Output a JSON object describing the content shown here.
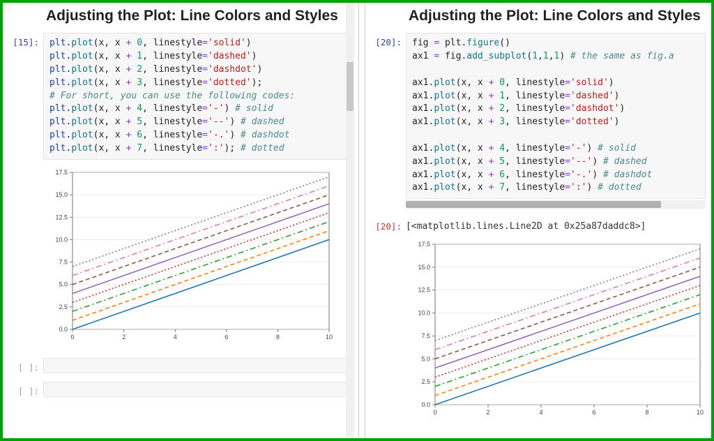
{
  "left": {
    "heading": "Adjusting the Plot: Line Colors and Styles",
    "prompt_in": "[15]:",
    "code_lines": [
      [
        [
          "plt",
          "k-blue"
        ],
        [
          ".",
          ""
        ],
        [
          "plot",
          "k-teal"
        ],
        [
          "(x, x ",
          ""
        ],
        [
          "+",
          "k-op"
        ],
        [
          " ",
          ""
        ],
        [
          "0",
          "k-green"
        ],
        [
          ", linestyle",
          ""
        ],
        [
          "=",
          "k-op"
        ],
        [
          "'solid'",
          "k-red"
        ],
        [
          ")",
          ""
        ]
      ],
      [
        [
          "plt",
          "k-blue"
        ],
        [
          ".",
          ""
        ],
        [
          "plot",
          "k-teal"
        ],
        [
          "(x, x ",
          ""
        ],
        [
          "+",
          "k-op"
        ],
        [
          " ",
          ""
        ],
        [
          "1",
          "k-green"
        ],
        [
          ", linestyle",
          ""
        ],
        [
          "=",
          "k-op"
        ],
        [
          "'dashed'",
          "k-red"
        ],
        [
          ")",
          ""
        ]
      ],
      [
        [
          "plt",
          "k-blue"
        ],
        [
          ".",
          ""
        ],
        [
          "plot",
          "k-teal"
        ],
        [
          "(x, x ",
          ""
        ],
        [
          "+",
          "k-op"
        ],
        [
          " ",
          ""
        ],
        [
          "2",
          "k-green"
        ],
        [
          ", linestyle",
          ""
        ],
        [
          "=",
          "k-op"
        ],
        [
          "'dashdot'",
          "k-red"
        ],
        [
          ")",
          ""
        ]
      ],
      [
        [
          "plt",
          "k-blue"
        ],
        [
          ".",
          ""
        ],
        [
          "plot",
          "k-teal"
        ],
        [
          "(x, x ",
          ""
        ],
        [
          "+",
          "k-op"
        ],
        [
          " ",
          ""
        ],
        [
          "3",
          "k-green"
        ],
        [
          ", linestyle",
          ""
        ],
        [
          "=",
          "k-op"
        ],
        [
          "'dotted'",
          "k-red"
        ],
        [
          ");",
          ""
        ]
      ],
      [
        [
          "# For short, you can use the following codes:",
          "k-cmt"
        ]
      ],
      [
        [
          "plt",
          "k-blue"
        ],
        [
          ".",
          ""
        ],
        [
          "plot",
          "k-teal"
        ],
        [
          "(x, x ",
          ""
        ],
        [
          "+",
          "k-op"
        ],
        [
          " ",
          ""
        ],
        [
          "4",
          "k-green"
        ],
        [
          ", linestyle",
          ""
        ],
        [
          "=",
          "k-op"
        ],
        [
          "'-'",
          "k-red"
        ],
        [
          ") ",
          ""
        ],
        [
          "# solid",
          "k-cmt"
        ]
      ],
      [
        [
          "plt",
          "k-blue"
        ],
        [
          ".",
          ""
        ],
        [
          "plot",
          "k-teal"
        ],
        [
          "(x, x ",
          ""
        ],
        [
          "+",
          "k-op"
        ],
        [
          " ",
          ""
        ],
        [
          "5",
          "k-green"
        ],
        [
          ", linestyle",
          ""
        ],
        [
          "=",
          "k-op"
        ],
        [
          "'--'",
          "k-red"
        ],
        [
          ") ",
          ""
        ],
        [
          "# dashed",
          "k-cmt"
        ]
      ],
      [
        [
          "plt",
          "k-blue"
        ],
        [
          ".",
          ""
        ],
        [
          "plot",
          "k-teal"
        ],
        [
          "(x, x ",
          ""
        ],
        [
          "+",
          "k-op"
        ],
        [
          " ",
          ""
        ],
        [
          "6",
          "k-green"
        ],
        [
          ", linestyle",
          ""
        ],
        [
          "=",
          "k-op"
        ],
        [
          "'-.'",
          "k-red"
        ],
        [
          ") ",
          ""
        ],
        [
          "# dashdot",
          "k-cmt"
        ]
      ],
      [
        [
          "plt",
          "k-blue"
        ],
        [
          ".",
          ""
        ],
        [
          "plot",
          "k-teal"
        ],
        [
          "(x, x ",
          ""
        ],
        [
          "+",
          "k-op"
        ],
        [
          " ",
          ""
        ],
        [
          "7",
          "k-green"
        ],
        [
          ", linestyle",
          ""
        ],
        [
          "=",
          "k-op"
        ],
        [
          "':'",
          "k-red"
        ],
        [
          "); ",
          ""
        ],
        [
          "# dotted",
          "k-cmt"
        ]
      ]
    ],
    "empty_prompt": "[ ]:",
    "scroll_thumb": {
      "top": 85,
      "height": 70
    }
  },
  "right": {
    "heading": "Adjusting the Plot: Line Colors and Styles",
    "prompt_in": "[20]:",
    "code_lines": [
      [
        [
          "fig ",
          ""
        ],
        [
          "=",
          "k-op"
        ],
        [
          " plt",
          ""
        ],
        [
          ".",
          ""
        ],
        [
          "figure",
          "k-teal"
        ],
        [
          "()",
          ""
        ]
      ],
      [
        [
          "ax1 ",
          ""
        ],
        [
          "=",
          "k-op"
        ],
        [
          " fig",
          ""
        ],
        [
          ".",
          ""
        ],
        [
          "add_subplot",
          "k-teal"
        ],
        [
          "(",
          ""
        ],
        [
          "1",
          "k-green"
        ],
        [
          ",",
          ""
        ],
        [
          "1",
          "k-green"
        ],
        [
          ",",
          ""
        ],
        [
          "1",
          "k-green"
        ],
        [
          ") ",
          ""
        ],
        [
          "# the same as fig.a",
          "k-cmt"
        ]
      ],
      [
        [
          "",
          ""
        ]
      ],
      [
        [
          "ax1",
          ""
        ],
        [
          ".",
          ""
        ],
        [
          "plot",
          "k-teal"
        ],
        [
          "(x, x ",
          ""
        ],
        [
          "+",
          "k-op"
        ],
        [
          " ",
          ""
        ],
        [
          "0",
          "k-green"
        ],
        [
          ", linestyle",
          ""
        ],
        [
          "=",
          "k-op"
        ],
        [
          "'solid'",
          "k-red"
        ],
        [
          ")",
          ""
        ]
      ],
      [
        [
          "ax1",
          ""
        ],
        [
          ".",
          ""
        ],
        [
          "plot",
          "k-teal"
        ],
        [
          "(x, x ",
          ""
        ],
        [
          "+",
          "k-op"
        ],
        [
          " ",
          ""
        ],
        [
          "1",
          "k-green"
        ],
        [
          ", linestyle",
          ""
        ],
        [
          "=",
          "k-op"
        ],
        [
          "'dashed'",
          "k-red"
        ],
        [
          ")",
          ""
        ]
      ],
      [
        [
          "ax1",
          ""
        ],
        [
          ".",
          ""
        ],
        [
          "plot",
          "k-teal"
        ],
        [
          "(x, x ",
          ""
        ],
        [
          "+",
          "k-op"
        ],
        [
          " ",
          ""
        ],
        [
          "2",
          "k-green"
        ],
        [
          ", linestyle",
          ""
        ],
        [
          "=",
          "k-op"
        ],
        [
          "'dashdot'",
          "k-red"
        ],
        [
          ")",
          ""
        ]
      ],
      [
        [
          "ax1",
          ""
        ],
        [
          ".",
          ""
        ],
        [
          "plot",
          "k-teal"
        ],
        [
          "(x, x ",
          ""
        ],
        [
          "+",
          "k-op"
        ],
        [
          " ",
          ""
        ],
        [
          "3",
          "k-green"
        ],
        [
          ", linestyle",
          ""
        ],
        [
          "=",
          "k-op"
        ],
        [
          "'dotted'",
          "k-red"
        ],
        [
          ")",
          ""
        ]
      ],
      [
        [
          "",
          ""
        ]
      ],
      [
        [
          "ax1",
          ""
        ],
        [
          ".",
          ""
        ],
        [
          "plot",
          "k-teal"
        ],
        [
          "(x, x ",
          ""
        ],
        [
          "+",
          "k-op"
        ],
        [
          " ",
          ""
        ],
        [
          "4",
          "k-green"
        ],
        [
          ", linestyle",
          ""
        ],
        [
          "=",
          "k-op"
        ],
        [
          "'-'",
          "k-red"
        ],
        [
          ") ",
          ""
        ],
        [
          "# solid",
          "k-cmt"
        ]
      ],
      [
        [
          "ax1",
          ""
        ],
        [
          ".",
          ""
        ],
        [
          "plot",
          "k-teal"
        ],
        [
          "(x, x ",
          ""
        ],
        [
          "+",
          "k-op"
        ],
        [
          " ",
          ""
        ],
        [
          "5",
          "k-green"
        ],
        [
          ", linestyle",
          ""
        ],
        [
          "=",
          "k-op"
        ],
        [
          "'--'",
          "k-red"
        ],
        [
          ") ",
          ""
        ],
        [
          "# dashed",
          "k-cmt"
        ]
      ],
      [
        [
          "ax1",
          ""
        ],
        [
          ".",
          ""
        ],
        [
          "plot",
          "k-teal"
        ],
        [
          "(x, x ",
          ""
        ],
        [
          "+",
          "k-op"
        ],
        [
          " ",
          ""
        ],
        [
          "6",
          "k-green"
        ],
        [
          ", linestyle",
          ""
        ],
        [
          "=",
          "k-op"
        ],
        [
          "'-.'",
          "k-red"
        ],
        [
          ") ",
          ""
        ],
        [
          "# dashdot",
          "k-cmt"
        ]
      ],
      [
        [
          "ax1",
          ""
        ],
        [
          ".",
          ""
        ],
        [
          "plot",
          "k-teal"
        ],
        [
          "(x, x ",
          ""
        ],
        [
          "+",
          "k-op"
        ],
        [
          " ",
          ""
        ],
        [
          "7",
          "k-green"
        ],
        [
          ", linestyle",
          ""
        ],
        [
          "=",
          "k-op"
        ],
        [
          "':'",
          "k-red"
        ],
        [
          ") ",
          ""
        ],
        [
          "# dotted",
          "k-cmt"
        ]
      ]
    ],
    "h_scroll_thumb": {
      "left": 0,
      "width_pct": 85
    },
    "prompt_out": "[20]:",
    "output_text": "[<matplotlib.lines.Line2D at 0x25a87daddc8>]"
  },
  "chart_data": {
    "type": "line",
    "x": [
      0,
      1,
      2,
      3,
      4,
      5,
      6,
      7,
      8,
      9,
      10
    ],
    "xlim": [
      0,
      10
    ],
    "ylim": [
      0,
      17.5
    ],
    "xticks": [
      0,
      2,
      4,
      6,
      8,
      10
    ],
    "yticks": [
      0.0,
      2.5,
      5.0,
      7.5,
      10.0,
      12.5,
      15.0,
      17.5
    ],
    "series": [
      {
        "name": "x+0",
        "offset": 0,
        "color": "#1f77b4",
        "style": "solid"
      },
      {
        "name": "x+1",
        "offset": 1,
        "color": "#ff7f0e",
        "style": "dashed"
      },
      {
        "name": "x+2",
        "offset": 2,
        "color": "#2ca02c",
        "style": "dashdot"
      },
      {
        "name": "x+3",
        "offset": 3,
        "color": "#d62728",
        "style": "dotted"
      },
      {
        "name": "x+4",
        "offset": 4,
        "color": "#9467bd",
        "style": "solid"
      },
      {
        "name": "x+5",
        "offset": 5,
        "color": "#8c564b",
        "style": "dashed"
      },
      {
        "name": "x+6",
        "offset": 6,
        "color": "#e377c2",
        "style": "dashdot"
      },
      {
        "name": "x+7",
        "offset": 7,
        "color": "#7f7f7f",
        "style": "dotted"
      }
    ]
  }
}
